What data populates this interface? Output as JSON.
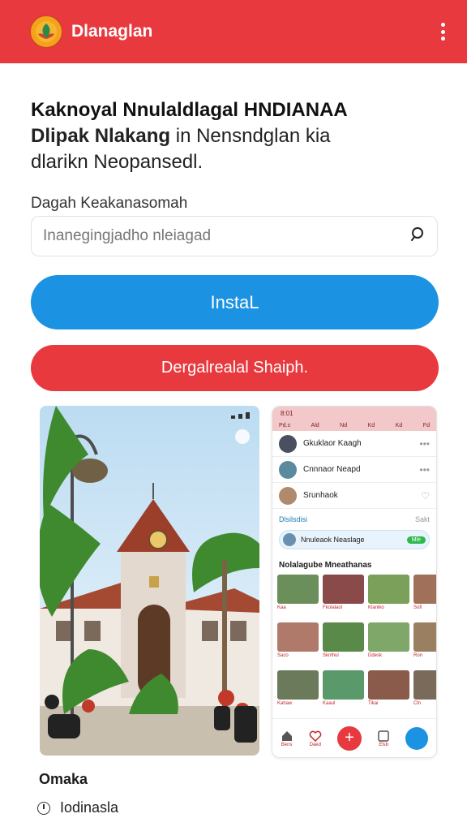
{
  "appbar": {
    "title": "Dlanaglan",
    "logo_icon": "app-logo-icon",
    "menu_icon": "more-vertical-icon",
    "color": "#e8393e"
  },
  "headline": {
    "line1": "Kaknoyal Nnulaldlagal HNDIANAA",
    "line2_bold": "Dlipak Nlakang",
    "line2_rest": " in Nensndglan kia",
    "line3": "dlarikn Neopansedl."
  },
  "search": {
    "label": "Dagah Keakanasomah",
    "placeholder": "Inanegingjadho nleiagad",
    "icon": "search-icon"
  },
  "buttons": {
    "install_label": "InstaL",
    "install_color": "#1b93e2",
    "share_label": "Dergalrealal Shaiph.",
    "share_color": "#e8393e"
  },
  "phone": {
    "status_time": "8:01",
    "tabs": [
      "Pd.s",
      "Ald",
      "Nd",
      "Kd",
      "Kd",
      "Fd"
    ],
    "contacts": [
      {
        "name": "Gkuklaor Kaagh",
        "action": "•••"
      },
      {
        "name": "Cnnnaor Neapd",
        "action": "•••"
      },
      {
        "name": "Srunhaok",
        "action": "♡"
      }
    ],
    "section_title": "Dlsilsdisi",
    "section_right": "Sakt",
    "pill_text": "Nnuleaok Neaslage",
    "pill_action": "Mle",
    "gallery_title": "Nolalagube Mneathanas",
    "gallery_captions": [
      "Kaa",
      "Fkolalaol",
      "Klanlko",
      "Sofi",
      "Saco",
      "Sknlhul",
      "Ddesk",
      "Ron",
      "Kahaw",
      "Kaaul",
      "Tikai",
      "Cln"
    ],
    "nav": [
      "Bens",
      "Daed",
      "",
      "Elsb",
      ""
    ]
  },
  "caption": {
    "title": "Omaka",
    "meta": "Iodinasla",
    "meta_icon": "clock-icon"
  }
}
